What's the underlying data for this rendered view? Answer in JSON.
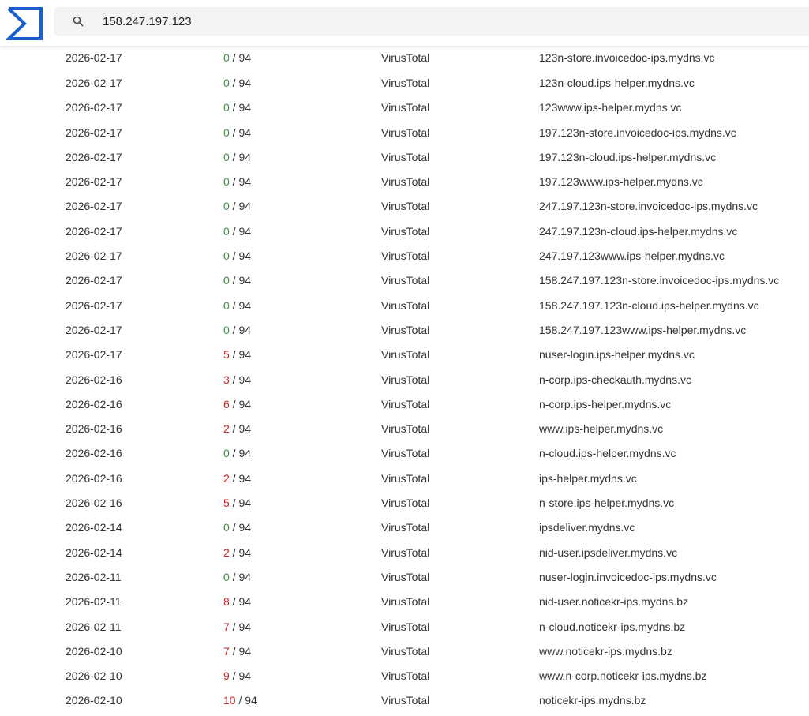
{
  "search": {
    "query": "158.247.197.123"
  },
  "colors": {
    "accent": "#1a5fd0",
    "clean": "#3e8e41",
    "malicious": "#c62828"
  },
  "rows": [
    {
      "date": "2026-02-17",
      "detections": "0",
      "total": "94",
      "source": "VirusTotal",
      "domain": "123n-store.invoicedoc-ips.mydns.vc"
    },
    {
      "date": "2026-02-17",
      "detections": "0",
      "total": "94",
      "source": "VirusTotal",
      "domain": "123n-cloud.ips-helper.mydns.vc"
    },
    {
      "date": "2026-02-17",
      "detections": "0",
      "total": "94",
      "source": "VirusTotal",
      "domain": "123www.ips-helper.mydns.vc"
    },
    {
      "date": "2026-02-17",
      "detections": "0",
      "total": "94",
      "source": "VirusTotal",
      "domain": "197.123n-store.invoicedoc-ips.mydns.vc"
    },
    {
      "date": "2026-02-17",
      "detections": "0",
      "total": "94",
      "source": "VirusTotal",
      "domain": "197.123n-cloud.ips-helper.mydns.vc"
    },
    {
      "date": "2026-02-17",
      "detections": "0",
      "total": "94",
      "source": "VirusTotal",
      "domain": "197.123www.ips-helper.mydns.vc"
    },
    {
      "date": "2026-02-17",
      "detections": "0",
      "total": "94",
      "source": "VirusTotal",
      "domain": "247.197.123n-store.invoicedoc-ips.mydns.vc"
    },
    {
      "date": "2026-02-17",
      "detections": "0",
      "total": "94",
      "source": "VirusTotal",
      "domain": "247.197.123n-cloud.ips-helper.mydns.vc"
    },
    {
      "date": "2026-02-17",
      "detections": "0",
      "total": "94",
      "source": "VirusTotal",
      "domain": "247.197.123www.ips-helper.mydns.vc"
    },
    {
      "date": "2026-02-17",
      "detections": "0",
      "total": "94",
      "source": "VirusTotal",
      "domain": "158.247.197.123n-store.invoicedoc-ips.mydns.vc"
    },
    {
      "date": "2026-02-17",
      "detections": "0",
      "total": "94",
      "source": "VirusTotal",
      "domain": "158.247.197.123n-cloud.ips-helper.mydns.vc"
    },
    {
      "date": "2026-02-17",
      "detections": "0",
      "total": "94",
      "source": "VirusTotal",
      "domain": "158.247.197.123www.ips-helper.mydns.vc"
    },
    {
      "date": "2026-02-17",
      "detections": "5",
      "total": "94",
      "source": "VirusTotal",
      "domain": "nuser-login.ips-helper.mydns.vc"
    },
    {
      "date": "2026-02-16",
      "detections": "3",
      "total": "94",
      "source": "VirusTotal",
      "domain": "n-corp.ips-checkauth.mydns.vc"
    },
    {
      "date": "2026-02-16",
      "detections": "6",
      "total": "94",
      "source": "VirusTotal",
      "domain": "n-corp.ips-helper.mydns.vc"
    },
    {
      "date": "2026-02-16",
      "detections": "2",
      "total": "94",
      "source": "VirusTotal",
      "domain": "www.ips-helper.mydns.vc"
    },
    {
      "date": "2026-02-16",
      "detections": "0",
      "total": "94",
      "source": "VirusTotal",
      "domain": "n-cloud.ips-helper.mydns.vc"
    },
    {
      "date": "2026-02-16",
      "detections": "2",
      "total": "94",
      "source": "VirusTotal",
      "domain": "ips-helper.mydns.vc"
    },
    {
      "date": "2026-02-16",
      "detections": "5",
      "total": "94",
      "source": "VirusTotal",
      "domain": "n-store.ips-helper.mydns.vc"
    },
    {
      "date": "2026-02-14",
      "detections": "0",
      "total": "94",
      "source": "VirusTotal",
      "domain": "ipsdeliver.mydns.vc"
    },
    {
      "date": "2026-02-14",
      "detections": "2",
      "total": "94",
      "source": "VirusTotal",
      "domain": "nid-user.ipsdeliver.mydns.vc"
    },
    {
      "date": "2026-02-11",
      "detections": "0",
      "total": "94",
      "source": "VirusTotal",
      "domain": "nuser-login.invoicedoc-ips.mydns.vc"
    },
    {
      "date": "2026-02-11",
      "detections": "8",
      "total": "94",
      "source": "VirusTotal",
      "domain": "nid-user.noticekr-ips.mydns.bz"
    },
    {
      "date": "2026-02-11",
      "detections": "7",
      "total": "94",
      "source": "VirusTotal",
      "domain": "n-cloud.noticekr-ips.mydns.bz"
    },
    {
      "date": "2026-02-10",
      "detections": "7",
      "total": "94",
      "source": "VirusTotal",
      "domain": "www.noticekr-ips.mydns.bz"
    },
    {
      "date": "2026-02-10",
      "detections": "9",
      "total": "94",
      "source": "VirusTotal",
      "domain": "www.n-corp.noticekr-ips.mydns.bz"
    },
    {
      "date": "2026-02-10",
      "detections": "10",
      "total": "94",
      "source": "VirusTotal",
      "domain": "noticekr-ips.mydns.bz"
    }
  ]
}
